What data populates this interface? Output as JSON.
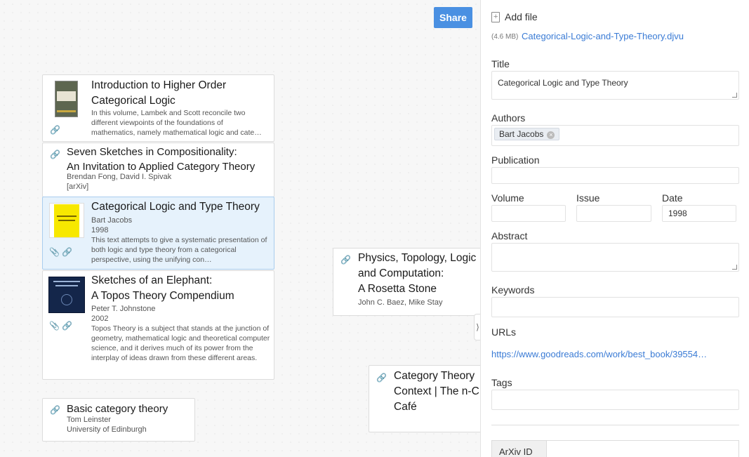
{
  "toolbar": {
    "share_label": "Share"
  },
  "cards": {
    "intro": {
      "title_line1": "Introduction to Higher Order",
      "title_line2": "Categorical Logic",
      "abstract": "In this volume, Lambek and Scott reconcile two different viewpoints of the foundations of mathematics, namely mathematical logic and cate…"
    },
    "seven": {
      "title_line1": "Seven Sketches in Compositionality:",
      "title_line2": "An Invitation to Applied Category Theory",
      "authors": "Brendan Fong, David I. Spivak",
      "source": "[arXiv]"
    },
    "clt": {
      "title": "Categorical Logic and Type Theory",
      "authors": "Bart Jacobs",
      "year": "1998",
      "abstract": "This text attempts to give a systematic presentation of both logic and type theory from a categorical perspective, using the unifying con…"
    },
    "elephant": {
      "title_line1": "Sketches of an Elephant:",
      "title_line2": "A Topos Theory Compendium",
      "authors": "Peter T. Johnstone",
      "year": "2002",
      "abstract": "Topos Theory is a subject that stands at the junction of geometry, mathematical logic and theoretical computer science, and it derives much of its power from the interplay of ideas drawn from these different areas."
    },
    "physics": {
      "title_line1": "Physics, Topology, Logic",
      "title_line2": "and Computation:",
      "title_line3": "A Rosetta Stone",
      "authors": "John C. Baez, Mike Stay"
    },
    "ctc": {
      "title_line1": "Category Theory",
      "title_line2": "Context | The n-C",
      "title_line3": "Café"
    },
    "basic": {
      "title": "Basic category theory",
      "authors": "Tom Leinster",
      "source": "University of Edinburgh"
    }
  },
  "panel": {
    "add_file_label": "Add file",
    "file_size": "(4.6 MB)",
    "file_name": "Categorical-Logic-and-Type-Theory.djvu",
    "title_label": "Title",
    "title_value": "Categorical Logic and Type Theory",
    "authors_label": "Authors",
    "author_chip": "Bart Jacobs",
    "author_chip_remove": "×",
    "publication_label": "Publication",
    "volume_label": "Volume",
    "issue_label": "Issue",
    "date_label": "Date",
    "date_value": "1998",
    "abstract_label": "Abstract",
    "keywords_label": "Keywords",
    "urls_label": "URLs",
    "url_value": "https://www.goodreads.com/work/best_book/39554…",
    "tags_label": "Tags",
    "arxiv_label": "ArXiv ID"
  },
  "icons": {
    "link": "🔗",
    "clip": "📎",
    "collapse": "⟩"
  }
}
